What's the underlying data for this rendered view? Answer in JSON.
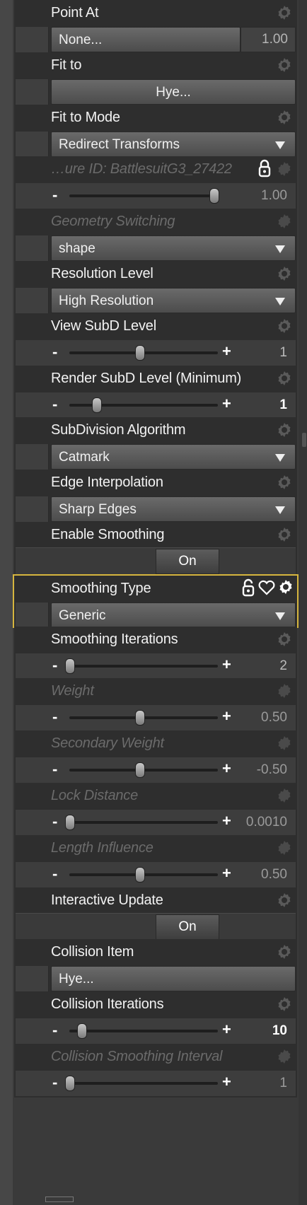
{
  "properties": [
    {
      "label": "Point At",
      "kind": "split",
      "value": "None...",
      "num": "1.00",
      "dim": false
    },
    {
      "label": "Fit to",
      "kind": "button_center",
      "value": "Hye...",
      "dim": false
    },
    {
      "label": "Fit to Mode",
      "kind": "dropdown",
      "value": "Redirect Transforms",
      "dim": false
    },
    {
      "label": "…ure ID: BattlesuitG3_27422",
      "kind": "slider",
      "minus": "-",
      "plus": "",
      "value": "1.00",
      "level": 0.97,
      "dim": true,
      "locked": true
    },
    {
      "label": "Geometry Switching",
      "kind": "dropdown",
      "value": "shape",
      "dim": true
    },
    {
      "label": "Resolution Level",
      "kind": "dropdown",
      "value": "High Resolution",
      "dim": false
    },
    {
      "label": "View SubD Level",
      "kind": "slider",
      "minus": "-",
      "plus": "+",
      "value": "1",
      "level": 0.47,
      "dim": false
    },
    {
      "label": "Render SubD Level (Minimum)",
      "kind": "slider",
      "minus": "-",
      "plus": "+",
      "value": "1",
      "level": 0.18,
      "dim": false,
      "boldval": true
    },
    {
      "label": "SubDivision Algorithm",
      "kind": "dropdown",
      "value": "Catmark",
      "dim": false
    },
    {
      "label": "Edge Interpolation",
      "kind": "dropdown",
      "value": "Sharp Edges",
      "dim": false
    },
    {
      "label": "Enable Smoothing",
      "kind": "toggle",
      "value": "On",
      "dim": false
    },
    {
      "label": "Smoothing Type",
      "kind": "dropdown",
      "value": "Generic",
      "dim": false,
      "selected": true
    },
    {
      "label": "Smoothing Iterations",
      "kind": "slider",
      "minus": "-",
      "plus": "+",
      "value": "2",
      "level": 0.0,
      "dim": false
    },
    {
      "label": "Weight",
      "kind": "slider",
      "minus": "-",
      "plus": "+",
      "value": "0.50",
      "level": 0.47,
      "dim": true
    },
    {
      "label": "Secondary Weight",
      "kind": "slider",
      "minus": "-",
      "plus": "+",
      "value": "-0.50",
      "level": 0.47,
      "dim": true
    },
    {
      "label": "Lock Distance",
      "kind": "slider",
      "minus": "-",
      "plus": "+",
      "value": "0.0010",
      "level": 0.0,
      "dim": true
    },
    {
      "label": "Length Influence",
      "kind": "slider",
      "minus": "-",
      "plus": "+",
      "value": "0.50",
      "level": 0.47,
      "dim": true
    },
    {
      "label": "Interactive Update",
      "kind": "toggle",
      "value": "On",
      "dim": false
    },
    {
      "label": "Collision Item",
      "kind": "button_left",
      "value": "Hye...",
      "dim": false
    },
    {
      "label": "Collision Iterations",
      "kind": "slider",
      "minus": "-",
      "plus": "+",
      "value": "10",
      "level": 0.08,
      "dim": false,
      "boldval": true
    },
    {
      "label": "Collision Smoothing Interval",
      "kind": "slider",
      "minus": "-",
      "plus": "+",
      "value": "1",
      "level": 0.0,
      "dim": true
    }
  ],
  "colors": {
    "highlight": "#d6b53e",
    "panel": "#2e2e2e"
  },
  "icons": {
    "gear": "gear-icon",
    "lock": "lock-icon",
    "heart": "heart-icon"
  }
}
